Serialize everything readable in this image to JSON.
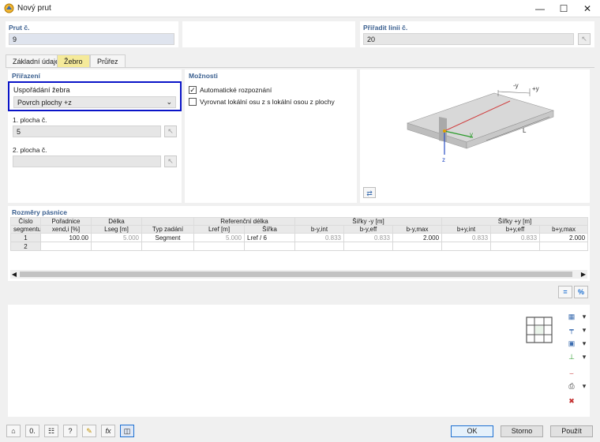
{
  "window": {
    "title": "Nový prut",
    "minimize": "—",
    "maximize": "☐",
    "close": "✕"
  },
  "prut": {
    "label": "Prut č.",
    "value": "9"
  },
  "priradit": {
    "label": "Přiřadit linii č.",
    "value": "20"
  },
  "tabs": [
    {
      "label": "Základní údaje"
    },
    {
      "label": "Žebro"
    },
    {
      "label": "Průřez"
    }
  ],
  "prirazeni": {
    "title": "Přiřazení",
    "usporadani_label": "Uspořádání žebra",
    "usporadani_value": "Povrch plochy +z",
    "plocha1_label": "1. plocha č.",
    "plocha1_value": "5",
    "plocha2_label": "2. plocha č.",
    "plocha2_value": ""
  },
  "moznosti": {
    "title": "Možnosti",
    "opt1_label": "Automatické rozpoznání",
    "opt1_checked": true,
    "opt2_label": "Vyrovnat lokální osu z s lokální osou z plochy",
    "opt2_checked": false
  },
  "figure": {
    "label_minus_y": "-y",
    "label_plus_y": "+y",
    "label_L": "L",
    "label_y": "y",
    "label_z": "z"
  },
  "rozmery": {
    "title": "Rozměry pásnice",
    "header1": [
      "Číslo",
      "Pořadnice",
      "Délka",
      "",
      "Referenční délka",
      "",
      "",
      "Šířky -y [m]",
      "",
      "",
      "Šířky +y [m]",
      ""
    ],
    "header2": [
      "segmentu",
      "xend,i [%]",
      "Lseg [m]",
      "Typ zadání",
      "Lref [m]",
      "Šířka",
      "b-y,int",
      "b-y,eff",
      "b-y,max",
      "b+y,int",
      "b+y,eff",
      "b+y,max"
    ],
    "rows": [
      [
        "1",
        "100.00",
        "5.000",
        "Segment",
        "5.000",
        "Lref / 6",
        "0.833",
        "0.833",
        "2.000",
        "0.833",
        "0.833",
        "2.000"
      ],
      [
        "2",
        "",
        "",
        "",
        "",
        "",
        "",
        "",
        "",
        "",
        "",
        ""
      ]
    ]
  },
  "view_buttons": {
    "equals": "=",
    "percent": "%"
  },
  "footer": {
    "ok": "OK",
    "cancel": "Storno",
    "apply": "Použít"
  },
  "colors": {
    "accent": "#1c6fd1",
    "highlight_border": "#0a14c8",
    "active_tab": "#f5ea9a"
  }
}
